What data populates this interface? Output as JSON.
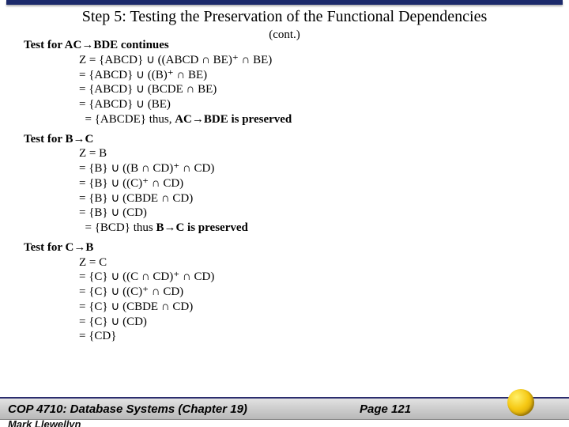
{
  "title": "Step 5: Testing the Preservation of the Functional Dependencies",
  "cont": "(cont.)",
  "test1": {
    "head": "Test for AC→BDE continues",
    "lines": [
      "Z = {ABCD} ∪ ((ABCD ∩ BE)⁺ ∩ BE)",
      "  = {ABCD} ∪ ((B)⁺ ∩ BE)",
      "  = {ABCD} ∪ (BCDE ∩ BE)",
      "  = {ABCD} ∪ (BE)",
      "  = {ABCDE} thus, AC→BDE is preserved"
    ]
  },
  "test2": {
    "head": "Test for B→C",
    "lines": [
      "Z = B",
      "  = {B} ∪ ((B ∩ CD)⁺ ∩ CD)",
      "  = {B} ∪ ((C)⁺ ∩ CD)",
      "  = {B} ∪ (CBDE ∩ CD)",
      "  = {B} ∪ (CD)",
      "  = {BCD} thus B→C is preserved"
    ]
  },
  "test3": {
    "head": "Test for C→B",
    "lines": [
      "Z = C",
      "  = {C} ∪ ((C ∩ CD)⁺ ∩ CD)",
      "  = {C} ∪ ((C)⁺ ∩ CD)",
      "  = {C} ∪ (CBDE ∩ CD)",
      "  = {C} ∪ (CD)",
      "  = {CD}"
    ]
  },
  "footer": {
    "course": "COP 4710: Database Systems  (Chapter 19)",
    "page": "Page 121",
    "author": "Mark Llewellyn"
  }
}
